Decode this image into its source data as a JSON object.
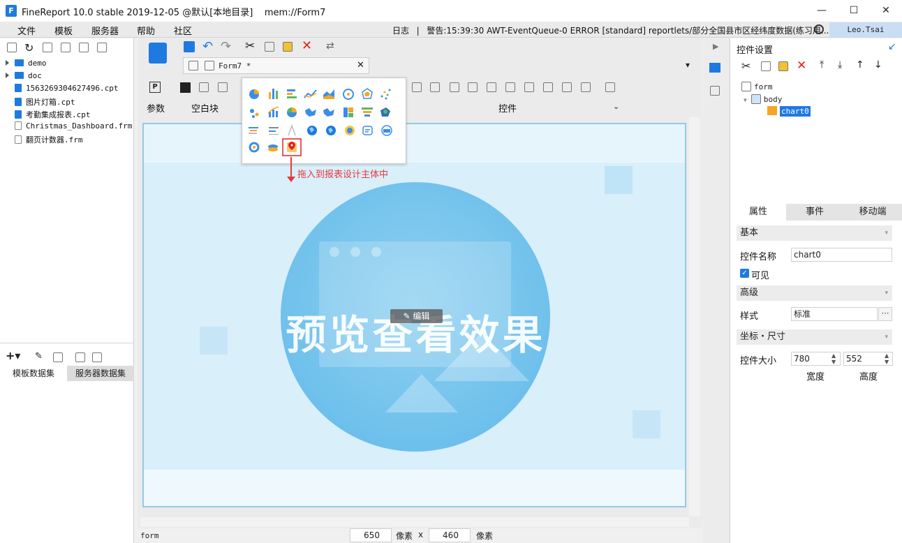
{
  "window": {
    "title": "FineReport 10.0 stable 2019-12-05 @默认[本地目录]    mem://Form7",
    "controls": [
      "—",
      "☐",
      "✕"
    ]
  },
  "menu": [
    "文件",
    "模板",
    "服务器",
    "帮助",
    "社区"
  ],
  "log": {
    "label": "日志",
    "separator": "|",
    "warning": "警告:15:39:30 AWT-EventQueue-0 ERROR [standard] reportlets/部分全国县市区经纬度数据(练习用..."
  },
  "user": "Leo.Tsai",
  "file_tree": [
    {
      "name": "demo",
      "type": "folder"
    },
    {
      "name": "doc",
      "type": "folder"
    },
    {
      "name": "1563269304627496.cpt",
      "type": "file"
    },
    {
      "name": "图片灯箱.cpt",
      "type": "file"
    },
    {
      "name": "考勤集成报表.cpt",
      "type": "file"
    },
    {
      "name": "Christmas_Dashboard.frm",
      "type": "file"
    },
    {
      "name": "翻页计数器.frm",
      "type": "file"
    }
  ],
  "dataset_tabs": [
    "模板数据集",
    "服务器数据集"
  ],
  "editor_tab": {
    "name": "Form7 *"
  },
  "widget_bar": {
    "param_label": "参数",
    "blank_label": "空白块",
    "widget_label": "控件"
  },
  "hint": "拖入到报表设计主体中",
  "designer": {
    "preview_text": "预览查看效果",
    "edit_label": "编辑"
  },
  "status_bar": {
    "scope": "form",
    "width": "650",
    "unit1": "像素",
    "x": "x",
    "height": "460",
    "unit2": "像素"
  },
  "right_panel": {
    "title": "控件设置",
    "tree": [
      "form",
      "body",
      "chart0"
    ],
    "tabs": [
      "属性",
      "事件",
      "移动端"
    ],
    "sections": {
      "basic": "基本",
      "advanced": "高级",
      "position": "坐标・尺寸"
    },
    "widget_name_label": "控件名称",
    "widget_name_value": "chart0",
    "visible_label": "可见",
    "style_label": "样式",
    "style_value": "标准",
    "size_label": "控件大小",
    "width_value": "780",
    "height_value": "552",
    "width_label": "宽度",
    "height_label": "高度"
  },
  "colors": {
    "accent": "#1f7ae0",
    "selection": "#1f7ae0",
    "red_delete": "#e02020",
    "hint_red": "#e8383d"
  }
}
